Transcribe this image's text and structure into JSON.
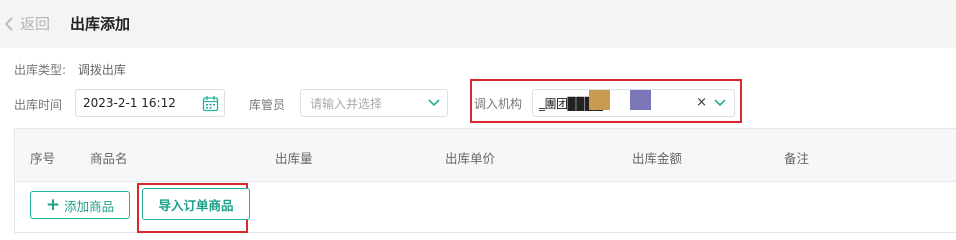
{
  "header": {
    "back_label": "返回",
    "title": "出库添加"
  },
  "form": {
    "type_label": "出库类型:",
    "type_value": "调拨出库",
    "time_label": "出库时间",
    "time_value": "2023-2-1 16:12",
    "manager_label": "库管员",
    "manager_placeholder": "请输入并选择",
    "org_label": "调入机构",
    "org_value": "‗團团▉▉▉▁"
  },
  "table": {
    "columns": [
      "序号",
      "商品名",
      "出库量",
      "出库单价",
      "出库金额",
      "备注"
    ]
  },
  "actions": {
    "add_label": "添加商品",
    "import_label": "导入订单商品"
  },
  "colors": {
    "accent": "#24b29a",
    "highlight": "#d9272e",
    "swatch_tan": "#c99a52",
    "swatch_purple": "#7a76b8"
  },
  "icons": {
    "back": "chevron-left-icon",
    "calendar": "calendar-icon",
    "dropdown": "chevron-down-icon",
    "clear": "close-icon",
    "add": "plus-icon"
  }
}
